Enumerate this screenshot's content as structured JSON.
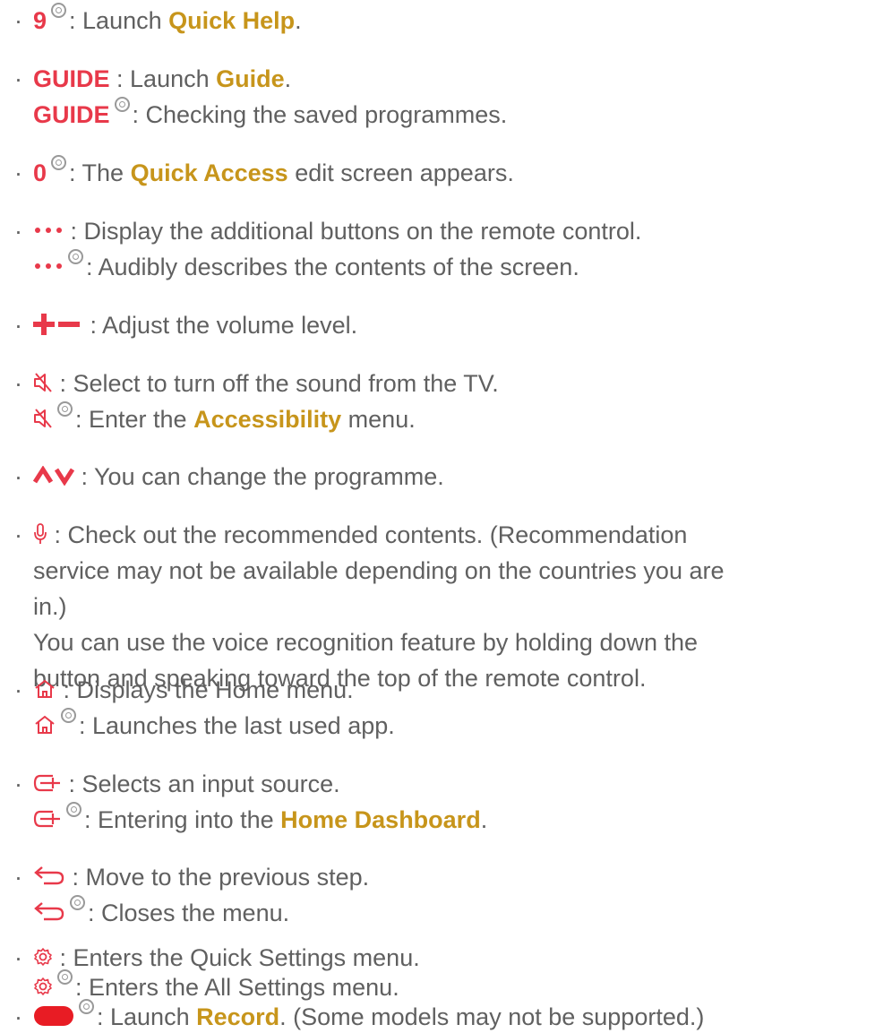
{
  "items": [
    {
      "lines": [
        {
          "key": "9",
          "text": ": Launch ",
          "link": "Quick Help",
          "tail": "."
        }
      ]
    },
    {
      "lines": [
        {
          "key": "GUIDE",
          "text": ": Launch ",
          "link": "Guide",
          "tail": "."
        },
        {
          "key": "GUIDE",
          "text": ": Checking the saved programmes."
        }
      ]
    },
    {
      "lines": [
        {
          "key": "0",
          "text": ": The ",
          "link": "Quick Access",
          "tail": " edit screen appears."
        }
      ]
    },
    {
      "lines": [
        {
          "text": ": Display the additional buttons on the remote control."
        },
        {
          "text": ": Audibly describes the contents of the screen."
        }
      ]
    },
    {
      "lines": [
        {
          "text": ": Adjust the volume level."
        }
      ]
    },
    {
      "lines": [
        {
          "text": ": Select to turn off the sound from the TV."
        },
        {
          "text": ": Enter the ",
          "link": "Accessibility",
          "tail": " menu."
        }
      ]
    },
    {
      "lines": [
        {
          "text": ": You can change the programme."
        }
      ]
    },
    {
      "lines": [
        {
          "text": ": Check out the recommended contents. (Recommendation"
        },
        {
          "text": "service may not be available depending on the countries you are"
        },
        {
          "text": "in.)"
        },
        {
          "text": "You can use the voice recognition feature by holding down the"
        },
        {
          "text": "button and speaking toward the top of the remote control."
        }
      ]
    },
    {
      "lines": [
        {
          "text": ": Displays the Home menu."
        },
        {
          "text": ": Launches the last used app."
        }
      ]
    },
    {
      "lines": [
        {
          "text": ": Selects an input source."
        },
        {
          "text": ": Entering into the ",
          "link": "Home Dashboard",
          "tail": "."
        }
      ]
    },
    {
      "lines": [
        {
          "text": ": Move to the previous step."
        },
        {
          "text": ": Closes the menu."
        }
      ]
    },
    {
      "lines": [
        {
          "text": ": Enters the Quick Settings menu."
        },
        {
          "text": ": Enters the All Settings menu."
        }
      ]
    },
    {
      "lines": [
        {
          "text": ": Launch ",
          "link": "Record",
          "tail": ". (Some models may not be supported.)"
        }
      ]
    }
  ],
  "bullet": "·",
  "colors": {
    "text": "#606060",
    "key_red": "#e8394a",
    "link_gold": "#c7951b",
    "long_press_ring": "#999999"
  },
  "icons": [
    "long-press-ring-icon",
    "more-dots-icon",
    "volume-plus-minus-icon",
    "mute-icon",
    "channel-up-down-icon",
    "microphone-icon",
    "home-icon",
    "input-source-icon",
    "back-arrow-icon",
    "settings-gear-icon",
    "record-button-icon"
  ]
}
